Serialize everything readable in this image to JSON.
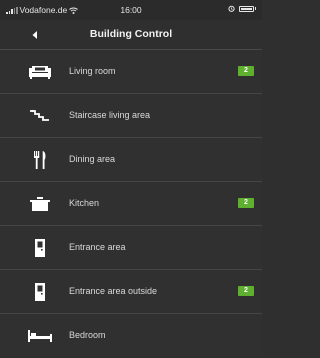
{
  "status_bar": {
    "carrier": "Vodafone.de",
    "time": "16:00"
  },
  "header": {
    "title": "Building Control"
  },
  "rooms": [
    {
      "label": "Living room",
      "icon": "sofa-icon",
      "badge": "2"
    },
    {
      "label": "Staircase living area",
      "icon": "stairs-icon",
      "badge": null
    },
    {
      "label": "Dining area",
      "icon": "cutlery-icon",
      "badge": null
    },
    {
      "label": "Kitchen",
      "icon": "cooking-pot-icon",
      "badge": "2"
    },
    {
      "label": "Entrance area",
      "icon": "door-icon",
      "badge": null
    },
    {
      "label": "Entrance area outside",
      "icon": "door-icon",
      "badge": "2"
    },
    {
      "label": "Bedroom",
      "icon": "bed-icon",
      "badge": null
    }
  ],
  "colors": {
    "background": "#303030",
    "badge": "#5fb02f",
    "divider": "#454545"
  }
}
